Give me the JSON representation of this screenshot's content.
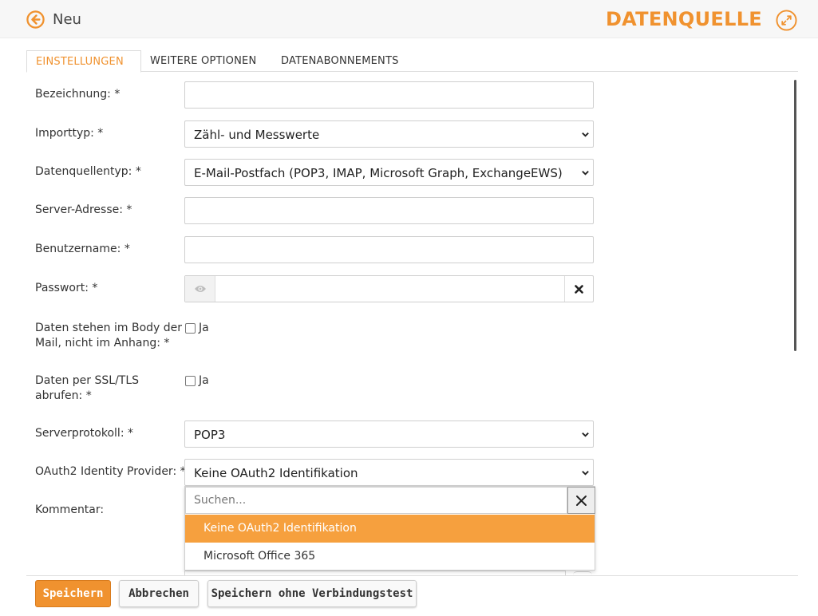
{
  "header": {
    "back_label": "Neu",
    "title": "DATENQUELLE",
    "accent_color": "#f0922f"
  },
  "tabs": [
    {
      "label": "EINSTELLUNGEN",
      "active": true
    },
    {
      "label": "WEITERE OPTIONEN",
      "active": false
    },
    {
      "label": "DATENABONNEMENTS",
      "active": false
    }
  ],
  "form": {
    "bezeichnung": {
      "label": "Bezeichnung:",
      "required": "*",
      "value": ""
    },
    "importtyp": {
      "label": "Importtyp:",
      "required": "*",
      "value": "Zähl- und Messwerte"
    },
    "datenquellentyp": {
      "label": "Datenquellentyp:",
      "required": "*",
      "value": "E-Mail-Postfach (POP3, IMAP, Microsoft Graph, ExchangeEWS)"
    },
    "server_adresse": {
      "label": "Server-Adresse:",
      "required": "*",
      "value": ""
    },
    "benutzername": {
      "label": "Benutzername:",
      "required": "*",
      "value": ""
    },
    "passwort": {
      "label": "Passwort:",
      "required": "*",
      "value": ""
    },
    "body_mail": {
      "label_line1": "Daten stehen im Body der",
      "label_line2": "Mail, nicht im Anhang:",
      "required": "*",
      "checkbox_label": "Ja",
      "checked": false
    },
    "ssl_tls": {
      "label_line1": "Daten per SSL/TLS",
      "label_line2": "abrufen:",
      "required": "*",
      "checkbox_label": "Ja",
      "checked": false
    },
    "serverprotokoll": {
      "label": "Serverprotokoll:",
      "required": "*",
      "value": "POP3"
    },
    "oauth2": {
      "label": "OAuth2 Identity Provider:",
      "required": "*",
      "value": "Keine OAuth2 Identifikation"
    },
    "kommentar": {
      "label": "Kommentar:"
    }
  },
  "dropdown": {
    "search_placeholder": "Suchen...",
    "options": [
      {
        "label": "Keine OAuth2 Identifikation",
        "selected": true
      },
      {
        "label": "Microsoft Office 365",
        "selected": false
      }
    ]
  },
  "footer": {
    "save_label": "Speichern",
    "cancel_label": "Abbrechen",
    "save_without_test_label": "Speichern ohne Verbindungstest"
  }
}
